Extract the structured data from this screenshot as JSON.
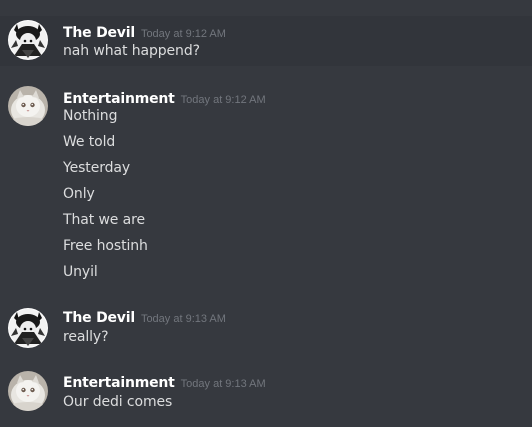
{
  "messages": [
    {
      "author": "The Devil",
      "timestamp": "Today at 9:12 AM",
      "avatar": "devil-avatar",
      "lines": [
        "nah what happend?"
      ]
    },
    {
      "author": "Entertainment",
      "timestamp": "Today at 9:12 AM",
      "avatar": "cat-avatar",
      "lines": [
        "Nothing",
        "We told",
        "Yesterday",
        "Only",
        "That we are",
        "Free hostinh",
        "Unyil"
      ]
    },
    {
      "author": "The Devil",
      "timestamp": "Today at 9:13 AM",
      "avatar": "devil-avatar",
      "lines": [
        "really?"
      ]
    },
    {
      "author": "Entertainment",
      "timestamp": "Today at 9:13 AM",
      "avatar": "cat-avatar",
      "lines": [
        "Our dedi comes"
      ]
    }
  ],
  "colors": {
    "background": "#36393f",
    "highlight": "#32353b",
    "username": "#ffffff",
    "timestamp": "#72767d",
    "text": "#dcddde"
  }
}
